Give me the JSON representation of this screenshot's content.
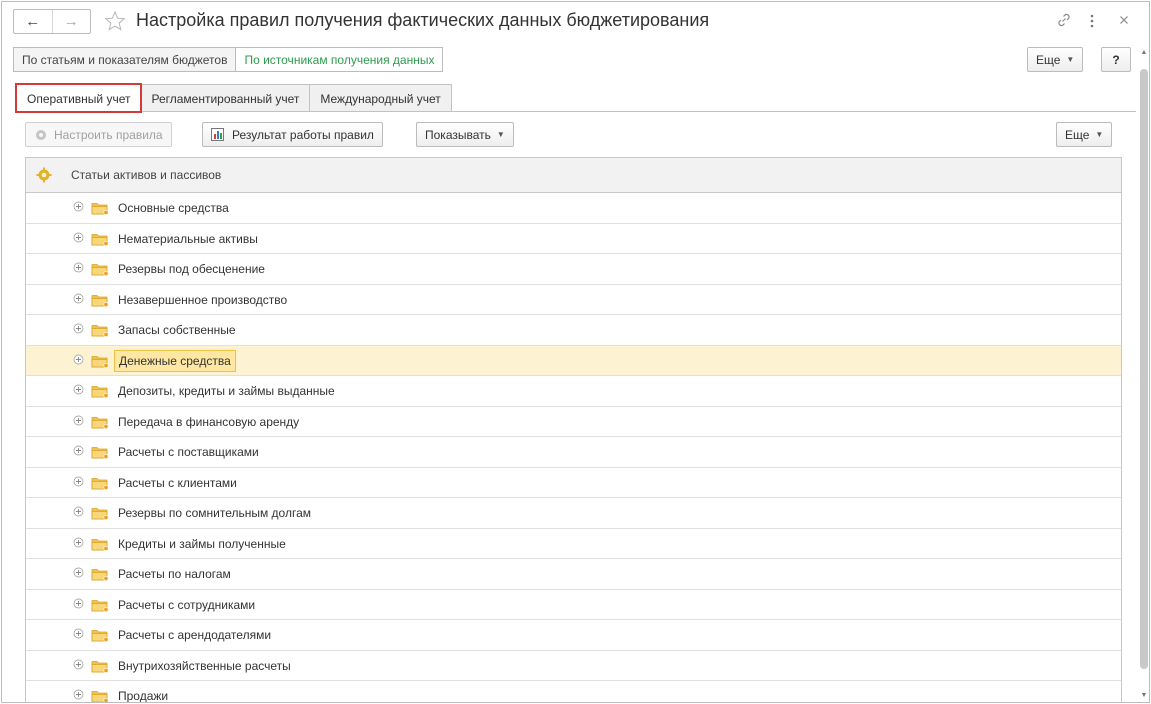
{
  "window": {
    "title": "Настройка правил получения фактических данных бюджетирования"
  },
  "nav": {
    "back": "←",
    "forward": "→"
  },
  "top_buttons": [
    {
      "label": "По статьям и показателям бюджетов",
      "active": false
    },
    {
      "label": "По источникам получения данных",
      "active": true
    }
  ],
  "header_actions": {
    "more_label": "Еще",
    "help_label": "?"
  },
  "tabs": [
    {
      "label": "Оперативный учет",
      "active": true
    },
    {
      "label": "Регламентированный учет",
      "active": false
    },
    {
      "label": "Международный учет",
      "active": false
    }
  ],
  "toolbar": {
    "configure_label": "Настроить правила",
    "result_label": "Результат работы правил",
    "show_label": "Показывать",
    "more_label": "Еще"
  },
  "table": {
    "column_header": "Статьи активов и пассивов",
    "selected_index": 5,
    "rows": [
      "Основные средства",
      "Нематериальные активы",
      "Резервы под обесценение",
      "Незавершенное производство",
      "Запасы собственные",
      "Денежные средства",
      "Депозиты, кредиты и займы выданные",
      "Передача в финансовую аренду",
      "Расчеты с поставщиками",
      "Расчеты с клиентами",
      "Резервы по сомнительным долгам",
      "Кредиты и займы полученные",
      "Расчеты по налогам",
      "Расчеты с сотрудниками",
      "Расчеты с арендодателями",
      "Внутрихозяйственные расчеты",
      "Продажи"
    ]
  },
  "colors": {
    "active_green": "#2f9a4b",
    "tab_highlight": "#d43a3a",
    "selected_row": "#fdf3d2",
    "folder": "#f3c24a"
  }
}
